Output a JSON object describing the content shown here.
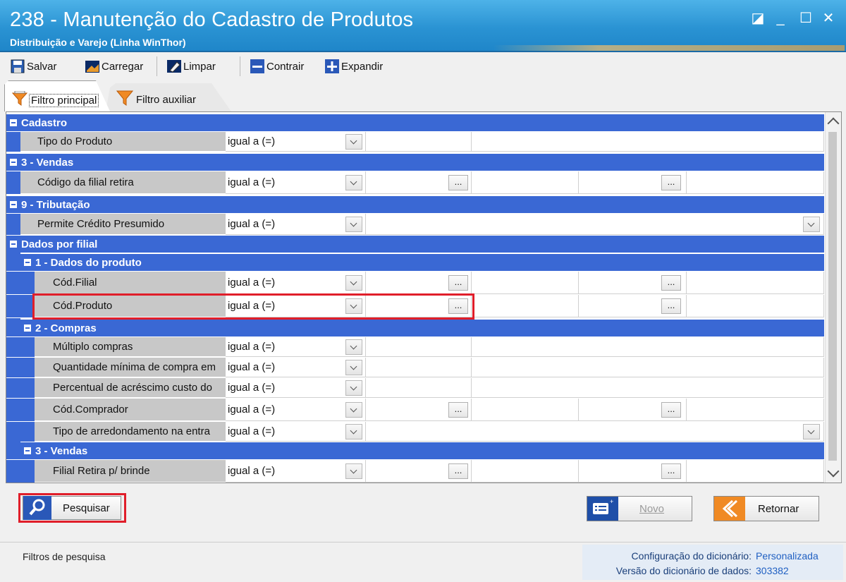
{
  "window": {
    "title": "238 - Manutenção do Cadastro de Produtos",
    "subtitle": "Distribuição e Varejo (Linha WinThor)",
    "controls": {
      "restore": "◪",
      "minimize": "_",
      "maximize": "☐",
      "close": "✕"
    }
  },
  "toolbar": {
    "salvar": "Salvar",
    "carregar": "Carregar",
    "limpar": "Limpar",
    "contrair": "Contrair",
    "expandir": "Expandir"
  },
  "tabs": {
    "principal": "Filtro principal",
    "auxiliar": "Filtro auxiliar"
  },
  "grid": {
    "ellipsis": "...",
    "groups": {
      "cadastro": "Cadastro",
      "vendas": "3 - Vendas",
      "tributacao": "9 - Tributação",
      "dados_filial": "Dados por filial",
      "dados_produto": "1 - Dados do produto",
      "compras": "2 - Compras",
      "vendas2": "3 - Vendas"
    },
    "rows": {
      "tipo_produto": {
        "label": "Tipo do Produto",
        "op": "igual a (=)"
      },
      "cod_filial_retira": {
        "label": "Código da filial retira",
        "op": "igual a (=)"
      },
      "credito_presumido": {
        "label": "Permite Crédito Presumido",
        "op": "igual a (=)"
      },
      "cod_filial": {
        "label": "Cód.Filial",
        "op": "igual a (=)"
      },
      "cod_produto": {
        "label": "Cód.Produto",
        "op": "igual a (=)"
      },
      "multiplo_compras": {
        "label": "Múltiplo compras",
        "op": "igual a (=)"
      },
      "qtd_minima": {
        "label": "Quantidade mínima de compra em",
        "op": "igual a (=)"
      },
      "perc_acrescimo": {
        "label": "Percentual de acréscimo custo do",
        "op": "igual a (=)"
      },
      "cod_comprador": {
        "label": "Cód.Comprador",
        "op": "igual a (=)"
      },
      "tipo_arredondamento": {
        "label": "Tipo de arredondamento na entra",
        "op": "igual a (=)"
      },
      "filial_retira_brinde": {
        "label": "Filial Retira p/ brinde",
        "op": "igual a (=)"
      }
    }
  },
  "buttons": {
    "pesquisar": "Pesquisar",
    "novo": "Novo",
    "retornar": "Retornar"
  },
  "status": {
    "left": "Filtros de pesquisa",
    "config_label": "Configuração do dicionário:",
    "config_value": "Personalizada",
    "version_label": "Versão do dicionário de dados:",
    "version_value": "303382"
  }
}
